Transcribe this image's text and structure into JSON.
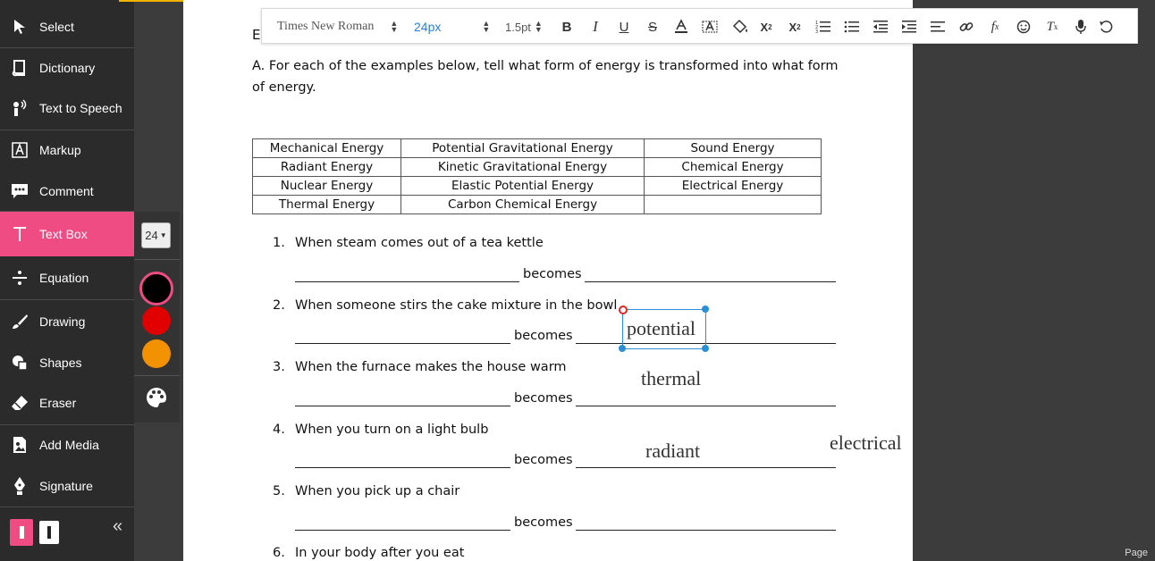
{
  "sidebar": {
    "tools": [
      {
        "label": "Select",
        "icon": "cursor-arrow-icon"
      },
      {
        "label": "Dictionary",
        "icon": "book-icon"
      },
      {
        "label": "Text to Speech",
        "icon": "speaker-person-icon"
      },
      {
        "label": "Markup",
        "icon": "highlighter-icon"
      },
      {
        "label": "Comment",
        "icon": "comment-bubble-icon"
      },
      {
        "label": "Text Box",
        "icon": "text-t-icon",
        "active": true
      },
      {
        "label": "Equation",
        "icon": "divide-icon"
      },
      {
        "label": "Drawing",
        "icon": "brush-icon"
      },
      {
        "label": "Shapes",
        "icon": "shapes-icon"
      },
      {
        "label": "Eraser",
        "icon": "eraser-icon"
      },
      {
        "label": "Add Media",
        "icon": "media-image-icon"
      },
      {
        "label": "Signature",
        "icon": "pen-nib-icon"
      }
    ],
    "collapse_glyph": "«",
    "active_color": "#ee4c82"
  },
  "subpalette": {
    "font_size": "24",
    "colors": [
      "#000000",
      "#e00000",
      "#f39200"
    ],
    "selected_color": "#000000"
  },
  "toolbar": {
    "font_family": "Times New Roman",
    "font_size": "24px",
    "line_height": "1.5pt",
    "buttons": [
      "bold",
      "italic",
      "underline",
      "strikethrough",
      "text-color",
      "highlight",
      "fill",
      "subscript",
      "superscript",
      "ordered-list",
      "bullet-list",
      "outdent",
      "indent",
      "align",
      "link",
      "formula",
      "emoji",
      "clear-format",
      "mic",
      "undo"
    ]
  },
  "document": {
    "heading_fragment": "E",
    "instructions": "A.  For each of the examples below, tell what form of energy is transformed into what form of energy.",
    "energy_table": [
      [
        "Mechanical Energy",
        "Potential Gravitational Energy",
        "Sound Energy"
      ],
      [
        "Radiant Energy",
        "Kinetic Gravitational Energy",
        "Chemical Energy"
      ],
      [
        "Nuclear Energy",
        "Elastic Potential Energy",
        "Electrical Energy"
      ],
      [
        "Thermal Energy",
        "Carbon Chemical Energy",
        ""
      ]
    ],
    "questions": [
      {
        "num": "1.",
        "text": "When steam comes out of a tea kettle"
      },
      {
        "num": "2.",
        "text": "When someone stirs the cake mixture in the bowl"
      },
      {
        "num": "3.",
        "text": "When the furnace makes the house warm"
      },
      {
        "num": "4.",
        "text": "When you turn on a light bulb"
      },
      {
        "num": "5.",
        "text": "When you pick up a chair"
      },
      {
        "num": "6.",
        "text": "In your body after you eat"
      }
    ],
    "becomes_word": "becomes",
    "text_boxes": [
      "potential",
      "thermal",
      "radiant",
      "electrical"
    ]
  },
  "footer": {
    "page_label": "Page"
  }
}
